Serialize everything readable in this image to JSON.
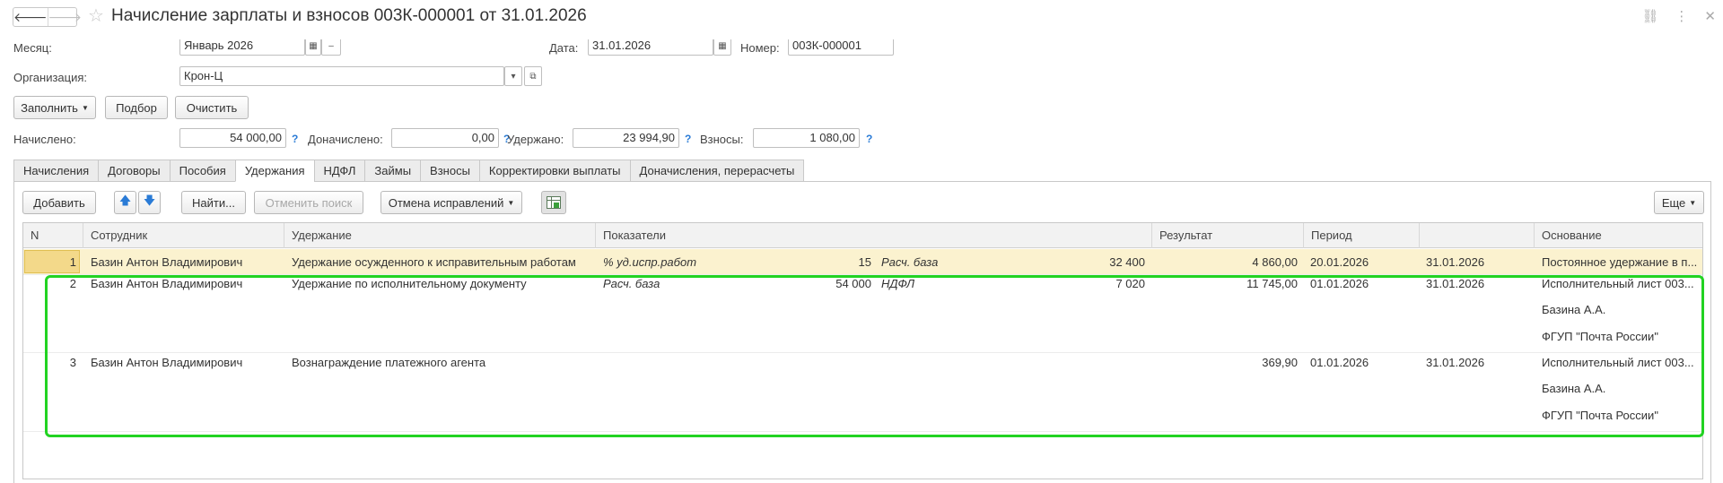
{
  "window": {
    "title": "Начисление зарплаты и взносов 003К-000001 от 31.01.2026",
    "back_glyph": "🡐",
    "forward_glyph": "🡒",
    "star_glyph": "☆",
    "link_glyph": "⛓",
    "more_glyph": "⋮",
    "close_glyph": "✕"
  },
  "header": {
    "month_label": "Месяц:",
    "month_value": "Январь 2026",
    "date_label": "Дата:",
    "date_value": "31.01.2026",
    "number_label": "Номер:",
    "number_value": "003К-000001",
    "org_label": "Организация:",
    "org_value": "Крон-Ц"
  },
  "toolbar": {
    "fill_label": "Заполнить",
    "select_label": "Подбор",
    "clear_label": "Очистить"
  },
  "totals": {
    "accrued_label": "Начислено:",
    "accrued_value": "54 000,00",
    "additional_label": "Доначислено:",
    "additional_value": "0,00",
    "withheld_label": "Удержано:",
    "withheld_value": "23 994,90",
    "contrib_label": "Взносы:",
    "contrib_value": "1 080,00",
    "help_glyph": "?"
  },
  "tabs": [
    "Начисления",
    "Договоры",
    "Пособия",
    "Удержания",
    "НДФЛ",
    "Займы",
    "Взносы",
    "Корректировки выплаты",
    "Доначисления, перерасчеты"
  ],
  "active_tab": "Удержания",
  "table_toolbar": {
    "add_label": "Добавить",
    "find_label": "Найти...",
    "cancel_search_label": "Отменить поиск",
    "cancel_fix_label": "Отмена исправлений",
    "more_label": "Еще",
    "up_glyph": "🡅",
    "down_glyph": "🡇"
  },
  "table": {
    "headers": [
      "N",
      "Сотрудник",
      "Удержание",
      "Показатели",
      "Результат",
      "Период",
      "",
      "Основание"
    ],
    "rows": [
      {
        "n": "1",
        "employee": "Базин Антон Владимирович",
        "deduction": "Удержание осужденного к исправительным работам",
        "ind1_name": "% уд.испр.работ",
        "ind1_value": "15",
        "ind2_name": "Расч. база",
        "ind2_value": "32 400",
        "result": "4 860,00",
        "period_start": "20.01.2026",
        "period_end": "31.01.2026",
        "basis": [
          "Постоянное удержание в п..."
        ]
      },
      {
        "n": "2",
        "employee": "Базин Антон Владимирович",
        "deduction": "Удержание по исполнительному документу",
        "ind1_name": "Расч. база",
        "ind1_value": "54 000",
        "ind2_name": "НДФЛ",
        "ind2_value": "7 020",
        "result": "11 745,00",
        "period_start": "01.01.2026",
        "period_end": "31.01.2026",
        "basis": [
          "Исполнительный лист 003...",
          "Базина А.А.",
          "ФГУП \"Почта России\""
        ]
      },
      {
        "n": "3",
        "employee": "Базин Антон Владимирович",
        "deduction": "Вознаграждение платежного агента",
        "ind1_name": "",
        "ind1_value": "",
        "ind2_name": "",
        "ind2_value": "",
        "result": "369,90",
        "period_start": "01.01.2026",
        "period_end": "31.01.2026",
        "basis": [
          "Исполнительный лист 003...",
          "Базина А.А.",
          "ФГУП \"Почта России\""
        ]
      }
    ]
  },
  "colors": {
    "highlight_border": "#22d322",
    "selected_row": "#fbf2cf",
    "help_blue": "#2a7bd6"
  }
}
